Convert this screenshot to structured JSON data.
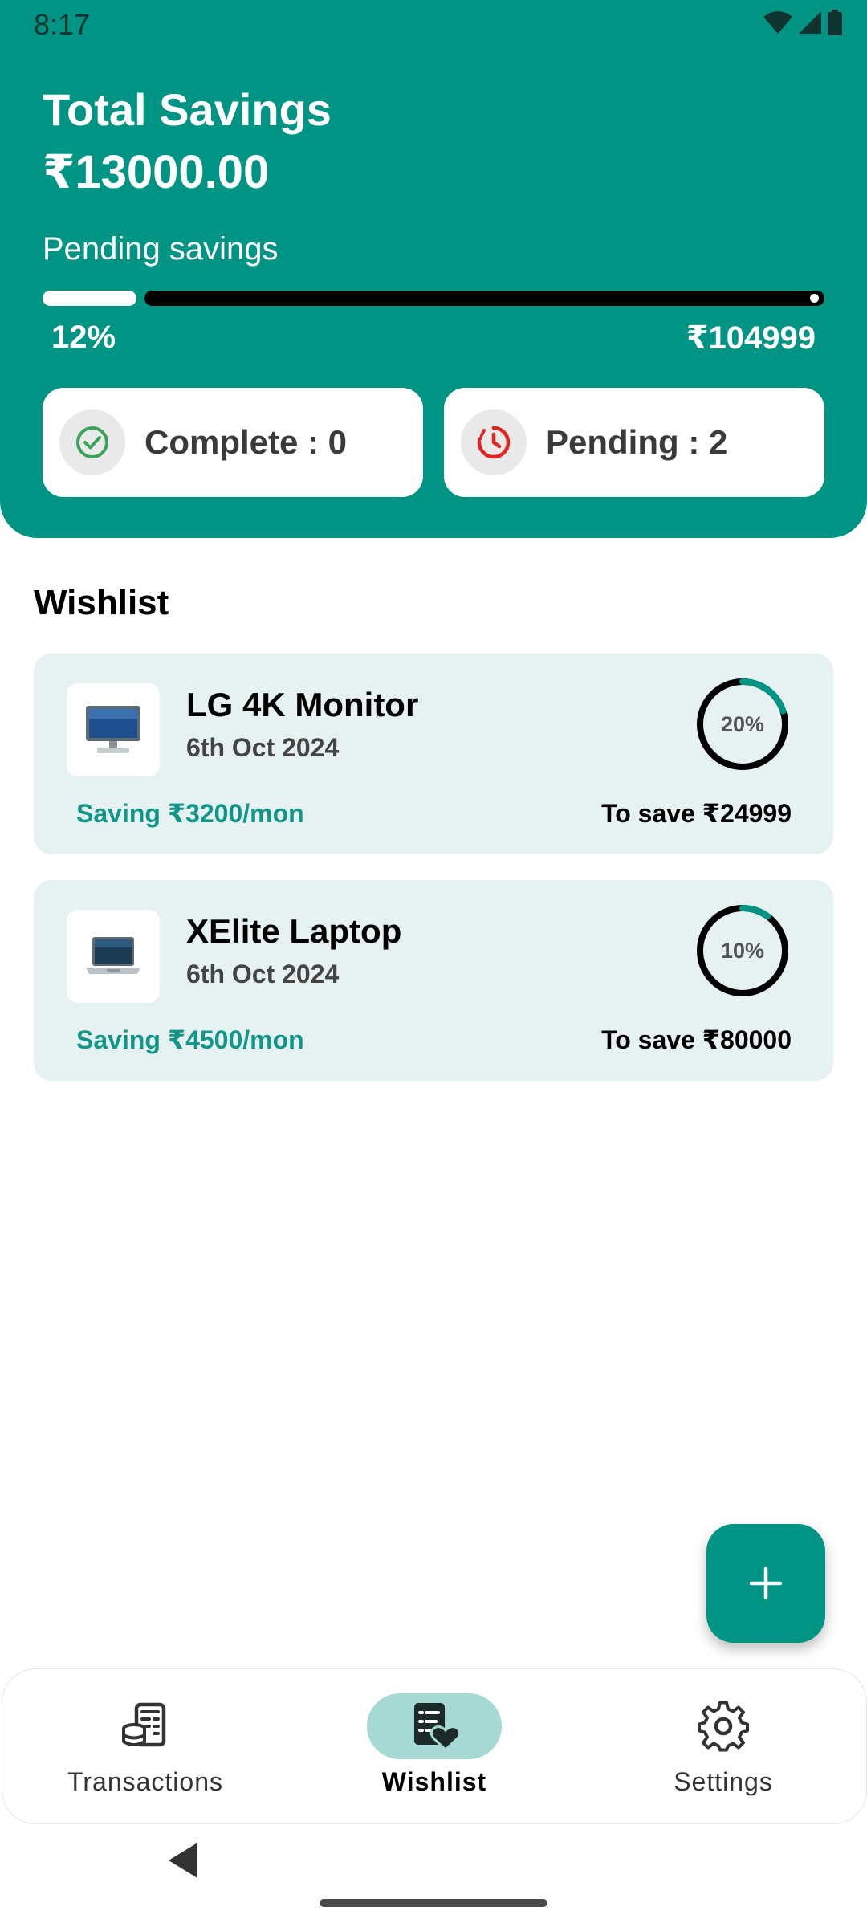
{
  "status_bar": {
    "time": "8:17"
  },
  "summary": {
    "title": "Total Savings",
    "total_value": "₹13000.00",
    "pending_label": "Pending savings",
    "progress_percent_text": "12%",
    "progress_fraction": 0.12,
    "remaining_amount": "₹104999",
    "complete_label": "Complete : 0",
    "pending_count_label": "Pending : 2"
  },
  "wishlist": {
    "title": "Wishlist",
    "items": [
      {
        "name": "LG 4K Monitor",
        "date": "6th Oct 2024",
        "saving": "Saving ₹3200/mon",
        "to_save": "To save ₹24999",
        "percent_text": "20%",
        "percent": 20,
        "icon": "monitor-icon"
      },
      {
        "name": "XElite Laptop",
        "date": "6th Oct 2024",
        "saving": "Saving ₹4500/mon",
        "to_save": "To save ₹80000",
        "percent_text": "10%",
        "percent": 10,
        "icon": "laptop-icon"
      }
    ]
  },
  "fab": {
    "icon": "plus-icon"
  },
  "bottom_nav": {
    "items": [
      {
        "label": "Transactions",
        "icon": "coins-icon",
        "active": false
      },
      {
        "label": "Wishlist",
        "icon": "wishlist-icon",
        "active": true
      },
      {
        "label": "Settings",
        "icon": "gear-icon",
        "active": false
      }
    ]
  },
  "colors": {
    "primary": "#009485",
    "card_background": "#e6f2f1",
    "saving_text": "#13968a",
    "active_nav_pill": "#a6d9d3",
    "complete_icon": "#3aa35a",
    "pending_icon": "#e02424"
  }
}
